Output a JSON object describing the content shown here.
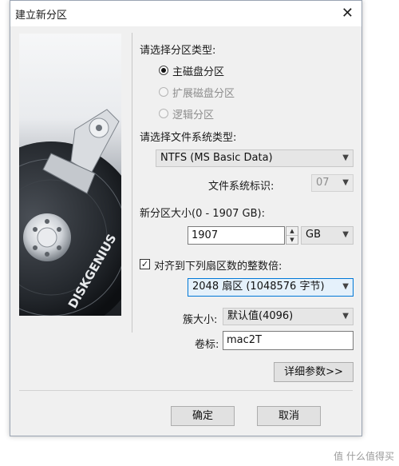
{
  "dialog": {
    "title": "建立新分区"
  },
  "partition_type": {
    "label": "请选择分区类型:",
    "options": [
      {
        "label": "主磁盘分区",
        "checked": true,
        "disabled": false
      },
      {
        "label": "扩展磁盘分区",
        "checked": false,
        "disabled": true
      },
      {
        "label": "逻辑分区",
        "checked": false,
        "disabled": true
      }
    ]
  },
  "filesystem": {
    "label": "请选择文件系统类型:",
    "selected": "NTFS (MS Basic Data)",
    "id_label": "文件系统标识:",
    "id_value": "07"
  },
  "size": {
    "label": "新分区大小(0 - 1907 GB):",
    "value": "1907",
    "unit": "GB"
  },
  "align": {
    "checked": true,
    "check_glyph": "✓",
    "label": "对齐到下列扇区数的整数倍:",
    "selected": "2048 扇区 (1048576 字节)"
  },
  "cluster": {
    "label": "簇大小:",
    "value": "默认值(4096)"
  },
  "volume": {
    "label": "卷标:",
    "value": "mac2T"
  },
  "buttons": {
    "details": "详细参数>>",
    "ok": "确定",
    "cancel": "取消"
  },
  "image": {
    "brand_text": "DISKGENIUS"
  },
  "watermark": "值 什么值得买",
  "colors": {
    "accent": "#0078d7",
    "dialog_bg": "#f0f0f0"
  }
}
